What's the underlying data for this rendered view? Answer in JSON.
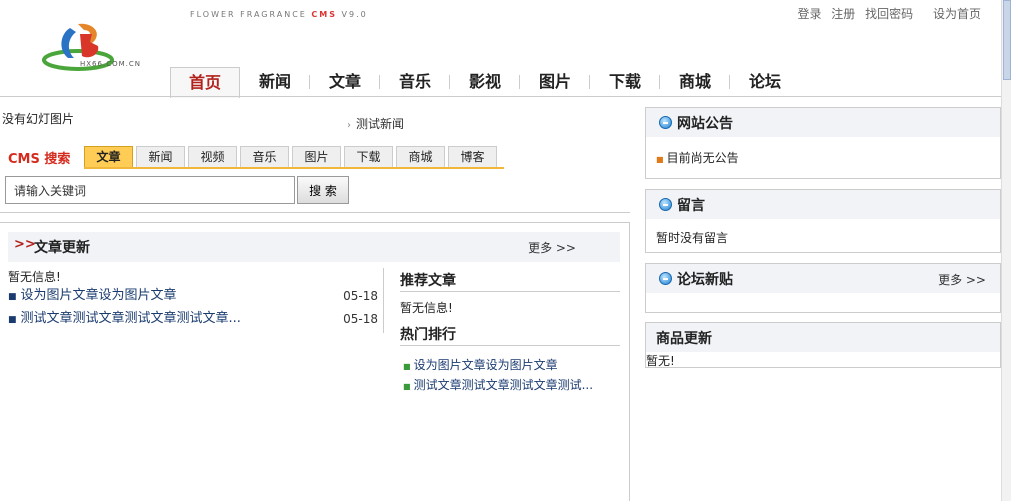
{
  "header": {
    "brand_prefix": "FLOWER FRAGRANCE",
    "brand_cms": "CMS",
    "brand_version": "V9.0",
    "logo_text": "HX66.COM.CN"
  },
  "top_links": {
    "login": "登录",
    "register": "注册",
    "recover": "找回密码",
    "sethome": "设为首页"
  },
  "nav": {
    "items": [
      {
        "label": "首页"
      },
      {
        "label": "新闻"
      },
      {
        "label": "文章"
      },
      {
        "label": "音乐"
      },
      {
        "label": "影视"
      },
      {
        "label": "图片"
      },
      {
        "label": "下载"
      },
      {
        "label": "商城"
      },
      {
        "label": "论坛"
      }
    ]
  },
  "slideshow": {
    "empty_text": "没有幻灯图片",
    "news_link": "测试新闻"
  },
  "search": {
    "logo_text": "CMS 搜索",
    "tabs": [
      {
        "label": "文章"
      },
      {
        "label": "新闻"
      },
      {
        "label": "视频"
      },
      {
        "label": "音乐"
      },
      {
        "label": "图片"
      },
      {
        "label": "下载"
      },
      {
        "label": "商城"
      },
      {
        "label": "博客"
      }
    ],
    "placeholder": "请输入关键词",
    "button_label": "搜 索"
  },
  "articles": {
    "title": "文章更新",
    "more": "更多 >>",
    "no_info": "暂无信息!",
    "rows": [
      {
        "title": "设为图片文章设为图片文章",
        "date": "05-18"
      },
      {
        "title": "测试文章测试文章测试文章测试文章...",
        "date": "05-18"
      }
    ]
  },
  "recommended": {
    "title": "推荐文章",
    "empty": "暂无信息!"
  },
  "hot": {
    "title": "热门排行",
    "items": [
      {
        "title": "设为图片文章设为图片文章"
      },
      {
        "title": "测试文章测试文章测试文章测试..."
      }
    ]
  },
  "sidebar": {
    "announcement": {
      "title": "网站公告",
      "item": "目前尚无公告"
    },
    "messages": {
      "title": "留言",
      "empty": "暂时没有留言"
    },
    "forum": {
      "title": "论坛新贴",
      "more": "更多 >>"
    },
    "products": {
      "title": "商品更新",
      "empty": "暂无!"
    }
  },
  "colors": {
    "accent_red": "#b2221c",
    "tab_active": "#ffcc55",
    "link_blue": "#1a3b70",
    "panel_bg": "#f1f3f7"
  }
}
